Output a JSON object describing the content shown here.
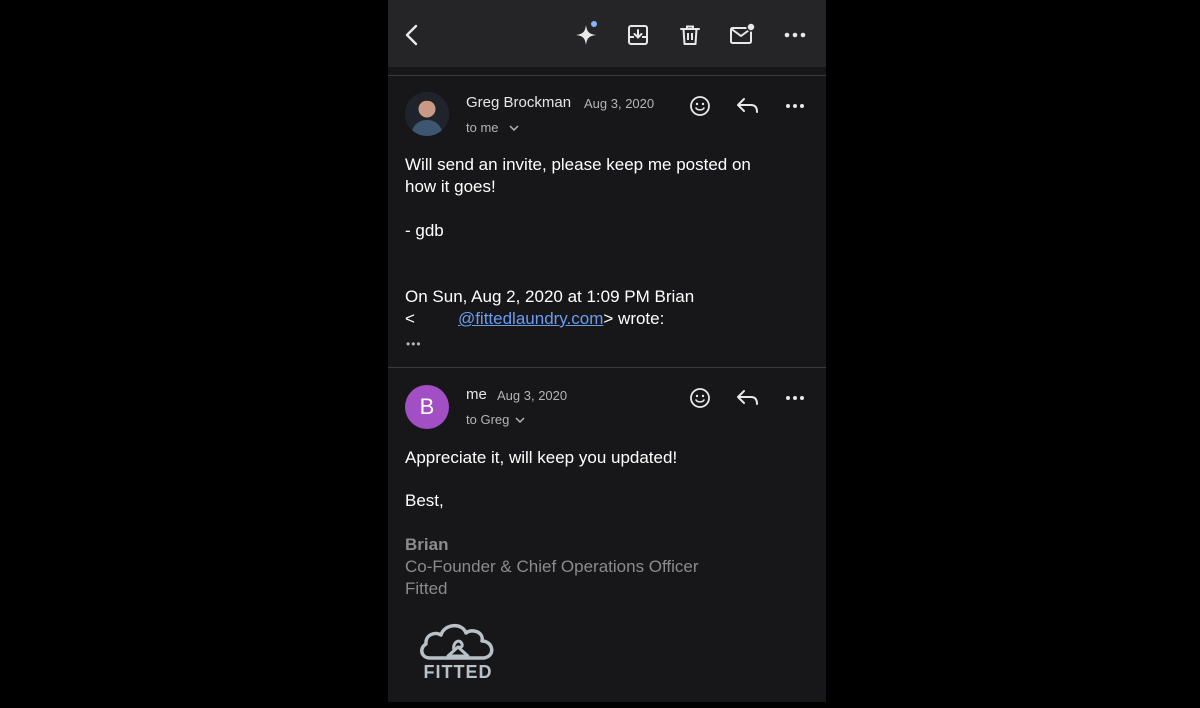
{
  "toolbar": {
    "back": "back-icon",
    "assistant": "sparkle-icon",
    "archive": "archive-icon",
    "delete": "trash-icon",
    "mark_unread": "mail-unread-icon",
    "more": "more-icon"
  },
  "messages": [
    {
      "sender": "Greg Brockman",
      "date": "Aug 3, 2020",
      "recipient": "to me",
      "body_lines": [
        "Will send an invite, please keep me posted on",
        "how it goes!"
      ],
      "signoff": "- gdb",
      "quote_header_line1": "On Sun, Aug 2, 2020 at 1:09 PM Brian",
      "quote_prefix": "<",
      "quote_email": "@fittedlaundry.com",
      "quote_suffix": "> wrote:",
      "show_quoted": "•••"
    },
    {
      "avatar_letter": "B",
      "sender": "me",
      "date": "Aug 3, 2020",
      "recipient": "to Greg",
      "body": "Appreciate it, will keep you updated!",
      "closing": "Best,",
      "signature_name": "Brian",
      "signature_title": "Co-Founder & Chief Operations Officer",
      "signature_company": "Fitted",
      "logo_text": "FITTED"
    }
  ],
  "colors": {
    "background": "#000000",
    "panel": "#171719",
    "toolbar": "#252527",
    "link": "#6a9cf2",
    "avatar": "#a24ec4",
    "notification_dot": "#8ab4f8"
  }
}
